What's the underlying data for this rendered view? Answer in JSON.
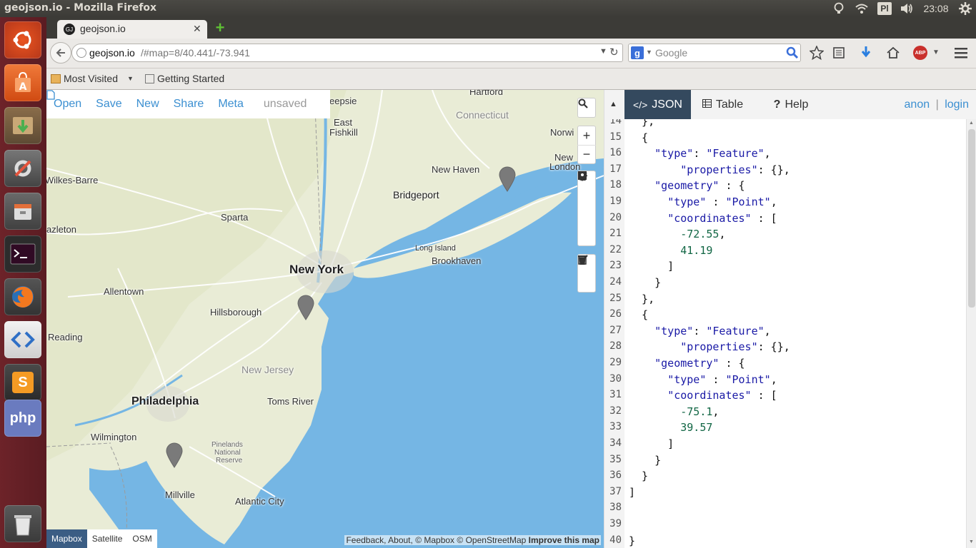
{
  "window": {
    "title": "geojson.io - Mozilla Firefox"
  },
  "tray": {
    "keyboard": "Pl",
    "clock": "23:08"
  },
  "launcher": {
    "items": [
      {
        "name": "dash-home-icon"
      },
      {
        "name": "software-center-icon"
      },
      {
        "name": "archive-manager-icon"
      },
      {
        "name": "system-settings-icon"
      },
      {
        "name": "file-manager-icon"
      },
      {
        "name": "terminal-icon"
      },
      {
        "name": "firefox-icon"
      },
      {
        "name": "code-editor-icon"
      },
      {
        "name": "sublime-text-icon"
      },
      {
        "name": "php-icon"
      },
      {
        "name": "trash-icon"
      }
    ],
    "php_label": "php",
    "sublime_label": "S"
  },
  "browser": {
    "tab_title": "geojson.io",
    "tab_favicon": "GJ",
    "url_host": "geojson.io",
    "url_path": "/#map=8/40.441/-73.941",
    "search_placeholder": "Google",
    "bookmarks": {
      "most_visited": "Most Visited",
      "getting_started": "Getting Started"
    }
  },
  "map": {
    "menu": [
      "Open",
      "Save",
      "New",
      "Share",
      "Meta"
    ],
    "unsaved_label": "unsaved",
    "places": {
      "hartford": "Hartford",
      "poughkeepsie": "eepsie",
      "connecticut": "Connecticut",
      "norwich": "Norwi",
      "east_fishkill_1": "East",
      "east_fishkill_2": "Fishkill",
      "new_london_1": "New",
      "new_london_2": "London",
      "new_haven": "New Haven",
      "wilkes_barre": "Wilkes-Barre",
      "bridgeport": "Bridgeport",
      "sparta": "Sparta",
      "hazleton": "azleton",
      "long_island": "Long Island",
      "brookhaven": "Brookhaven",
      "new_york": "New York",
      "allentown": "Allentown",
      "hillsborough": "Hillsborough",
      "reading": "Reading",
      "new_jersey": "New Jersey",
      "philadelphia": "Philadelphia",
      "toms_river": "Toms River",
      "wilmington": "Wilmington",
      "pinelands_1": "Pinelands",
      "pinelands_2": "National",
      "pinelands_3": "Reserve",
      "millville": "Millville",
      "atlantic_city": "Atlantic City"
    },
    "layers": [
      "Mapbox",
      "Satellite",
      "OSM"
    ],
    "active_layer": "Mapbox",
    "attribution": {
      "feedback": "Feedback",
      "about": "About",
      "mapbox": "© Mapbox",
      "osm": "© OpenStreetMap",
      "improve": "Improve this map"
    }
  },
  "panel": {
    "tabs": [
      "JSON",
      "Table",
      "Help"
    ],
    "active_tab": "JSON",
    "auth": {
      "anon": "anon",
      "sep": "|",
      "login": "login"
    }
  },
  "editor": {
    "lines": [
      {
        "n": "14",
        "t": "  },"
      },
      {
        "n": "15",
        "t": "  {"
      },
      {
        "n": "16",
        "t": "    \"type\": \"Feature\","
      },
      {
        "n": "17",
        "t": "        \"properties\": {},"
      },
      {
        "n": "18",
        "t": "    \"geometry\" : {"
      },
      {
        "n": "19",
        "t": "      \"type\" : \"Point\","
      },
      {
        "n": "20",
        "t": "      \"coordinates\" : ["
      },
      {
        "n": "21",
        "t": "        -72.55,"
      },
      {
        "n": "22",
        "t": "        41.19"
      },
      {
        "n": "23",
        "t": "      ]"
      },
      {
        "n": "24",
        "t": "    }"
      },
      {
        "n": "25",
        "t": "  },"
      },
      {
        "n": "26",
        "t": "  {"
      },
      {
        "n": "27",
        "t": "    \"type\": \"Feature\","
      },
      {
        "n": "28",
        "t": "        \"properties\": {},"
      },
      {
        "n": "29",
        "t": "    \"geometry\" : {"
      },
      {
        "n": "30",
        "t": "      \"type\" : \"Point\","
      },
      {
        "n": "31",
        "t": "      \"coordinates\" : ["
      },
      {
        "n": "32",
        "t": "        -75.1,"
      },
      {
        "n": "33",
        "t": "        39.57"
      },
      {
        "n": "34",
        "t": "      ]"
      },
      {
        "n": "35",
        "t": "    }"
      },
      {
        "n": "36",
        "t": "  }"
      },
      {
        "n": "37",
        "t": "]"
      },
      {
        "n": "38",
        "t": ""
      },
      {
        "n": "39",
        "t": ""
      },
      {
        "n": "40",
        "t": "}"
      }
    ]
  }
}
